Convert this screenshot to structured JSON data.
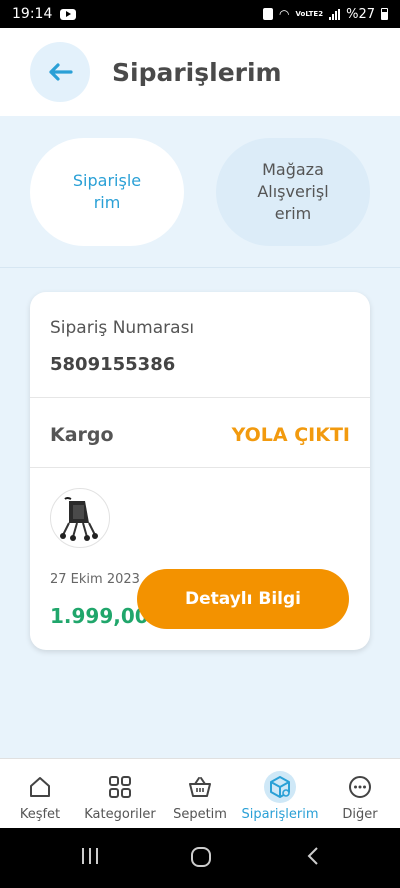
{
  "status_bar": {
    "time": "19:14",
    "lte": "VoLTE2",
    "battery": "%27"
  },
  "header": {
    "title": "Siparişlerim"
  },
  "tabs": [
    {
      "label": "Siparişle rim",
      "active": true
    },
    {
      "label": "Mağaza Alışverişl erim",
      "active": false
    }
  ],
  "order": {
    "number_label": "Sipariş Numarası",
    "number": "5809155386",
    "cargo_label": "Kargo",
    "cargo_status": "YOLA ÇIKTI",
    "date": "27 Ekim 2023",
    "price": "1.999,00",
    "details_button": "Detaylı Bilgi"
  },
  "bottom_nav": [
    {
      "label": "Keşfet",
      "icon": "home-icon"
    },
    {
      "label": "Kategoriler",
      "icon": "grid-icon"
    },
    {
      "label": "Sepetim",
      "icon": "basket-icon"
    },
    {
      "label": "Siparişlerim",
      "icon": "orders-icon",
      "active": true
    },
    {
      "label": "Diğer",
      "icon": "more-icon"
    }
  ],
  "colors": {
    "accent": "#2aa0d6",
    "orange": "#f39200",
    "status": "#f29a0e",
    "price": "#20a66b",
    "background": "#e8f3fb"
  }
}
